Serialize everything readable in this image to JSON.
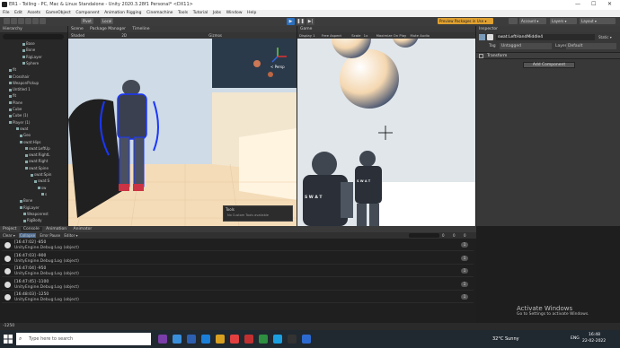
{
  "window": {
    "title": "ER1 - Toiling - PC, Mac & Linux Standalone - Unity 2020.3.28f1 Personal* <DX11>",
    "min": "—",
    "max": "☐",
    "close": "✕"
  },
  "menu": [
    "File",
    "Edit",
    "Assets",
    "GameObject",
    "Component",
    "Animation Rigging",
    "Cinemachine",
    "Tools",
    "Tutorial",
    "Jobs",
    "Window",
    "Help"
  ],
  "toolbar": {
    "pivot": "Pivot",
    "local": "Local",
    "packages": "Preview Packages in Use ▾",
    "account": "Account ▾",
    "layers": "Layers ▾",
    "layout": "Layout ▾"
  },
  "hierarchy": {
    "tab": "Hierarchy",
    "rows": [
      "Base",
      "Bone",
      "RigLayer",
      "Sphere",
      "fit",
      "Crosshair",
      "WeaponPickup",
      "Untitled 1",
      "fit",
      "Plane",
      "Cube",
      "Cube (1)",
      "Player (1)",
      "swat",
      "Geo",
      "swat:Hips",
      "swat:LeftUp",
      "swat:RightL",
      "swat:Right",
      "swat:Spine",
      "swat:Spin",
      "swat:S",
      "sw",
      "s",
      "Bone",
      "RigLayer",
      "Weaponrest",
      "RigBody"
    ]
  },
  "scene": {
    "tabs": [
      "Scene",
      "Package Manager",
      "Timeline"
    ],
    "shading": "Shaded",
    "mode": "2D",
    "gizmos": "Gizmos",
    "persp": "< Persp",
    "tools_title": "Tools",
    "tools_text": "No Custom Tools available"
  },
  "game": {
    "tab": "Game",
    "display": "Display 1",
    "aspect": "Free Aspect",
    "scale": "Scale",
    "scale_val": "1x",
    "max": "Maximize On Play",
    "mute": "Mute Audio",
    "swat1": "S W A T",
    "swat2": "S W A T"
  },
  "inspector": {
    "tab": "Inspector",
    "object": "swat:LeftHandMiddle4",
    "static": "Static ▾",
    "tag_label": "Tag",
    "tag": "Untagged",
    "layer_label": "Layer",
    "layer": "Default",
    "transform": "Transform",
    "add": "Add Component"
  },
  "console": {
    "tabs": [
      "Project",
      "Console",
      "Animation",
      "Animator"
    ],
    "clear": "Clear ▾",
    "collapse": "Collapse",
    "error_pause": "Error Pause",
    "editor": "Editor ▾",
    "counts": [
      "0",
      "0",
      "0"
    ],
    "rows": [
      {
        "l1": "[16:47:02] -850",
        "l2": "UnityEngine.Debug:Log (object)",
        "cnt": "1"
      },
      {
        "l1": "[16:47:03] -900",
        "l2": "UnityEngine.Debug:Log (object)",
        "cnt": "1"
      },
      {
        "l1": "[16:47:04] -950",
        "l2": "UnityEngine.Debug:Log (object)",
        "cnt": "1"
      },
      {
        "l1": "[16:47:45] -1100",
        "l2": "UnityEngine.Debug:Log (object)",
        "cnt": "1"
      },
      {
        "l1": "[16:48:03] -1250",
        "l2": "UnityEngine.Debug:Log (object)",
        "cnt": "1"
      }
    ]
  },
  "status": "-1250",
  "activation": {
    "title": "Activate Windows",
    "sub": "Go to Settings to activate Windows."
  },
  "taskbar": {
    "search": "Type here to search",
    "weather": "32°C  Sunny",
    "lang": "ENG",
    "time": "16:48",
    "date": "22-02-2022",
    "colors": [
      "#7a3ea8",
      "#3a8fdb",
      "#2d5fb0",
      "#1a7fd8",
      "#d8a020",
      "#e04040",
      "#c03030",
      "#2d8f3f",
      "#1aa0e0",
      "#333333",
      "#2d6ad0"
    ]
  }
}
